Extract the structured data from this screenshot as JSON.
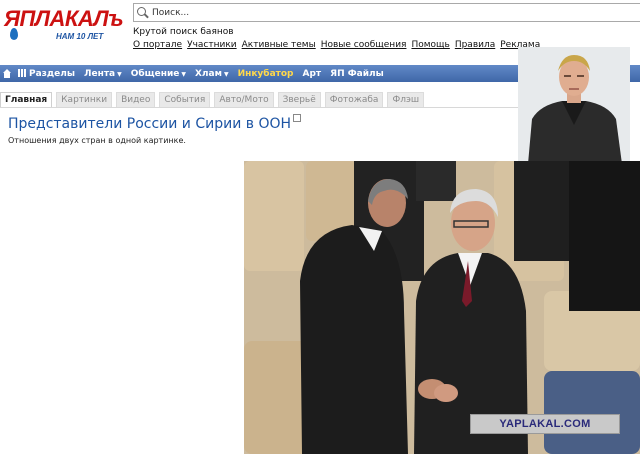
{
  "logo": {
    "text": "ЯПЛАКАЛъ",
    "subtitle": "НАМ 10 ЛЕТ"
  },
  "search": {
    "placeholder": "Поиск..."
  },
  "tagline": "Крутой поиск баянов",
  "top_links": [
    "О портале",
    "Участники",
    "Активные темы",
    "Новые сообщения",
    "Помощь",
    "Правила",
    "Реклама"
  ],
  "nav": {
    "items": [
      {
        "label": "Разделы",
        "icon": "bars-icon",
        "dropdown": false
      },
      {
        "label": "Лента",
        "dropdown": true
      },
      {
        "label": "Общение",
        "dropdown": true
      },
      {
        "label": "Хлам",
        "dropdown": true
      },
      {
        "label": "Инкубатор",
        "dropdown": false,
        "highlight": true
      },
      {
        "label": "Арт",
        "dropdown": false
      },
      {
        "label": "ЯП Файлы",
        "dropdown": false
      }
    ]
  },
  "tabs": [
    {
      "label": "Главная",
      "active": true
    },
    {
      "label": "Картинки",
      "active": false
    },
    {
      "label": "Видео",
      "active": false
    },
    {
      "label": "События",
      "active": false
    },
    {
      "label": "Авто/Мото",
      "active": false
    },
    {
      "label": "Зверьё",
      "active": false
    },
    {
      "label": "Фотожаба",
      "active": false
    },
    {
      "label": "Флэш",
      "active": false
    }
  ],
  "post": {
    "title": "Представители России и Сирии в ООН",
    "subtitle": "Отношения двух стран в одной картинке."
  },
  "watermark": "YAPLAKAL.COM",
  "colors": {
    "nav_bg": "#4f78b8",
    "link_blue": "#1d54a3",
    "logo_red": "#cc1111",
    "highlight": "#ffd84a"
  }
}
